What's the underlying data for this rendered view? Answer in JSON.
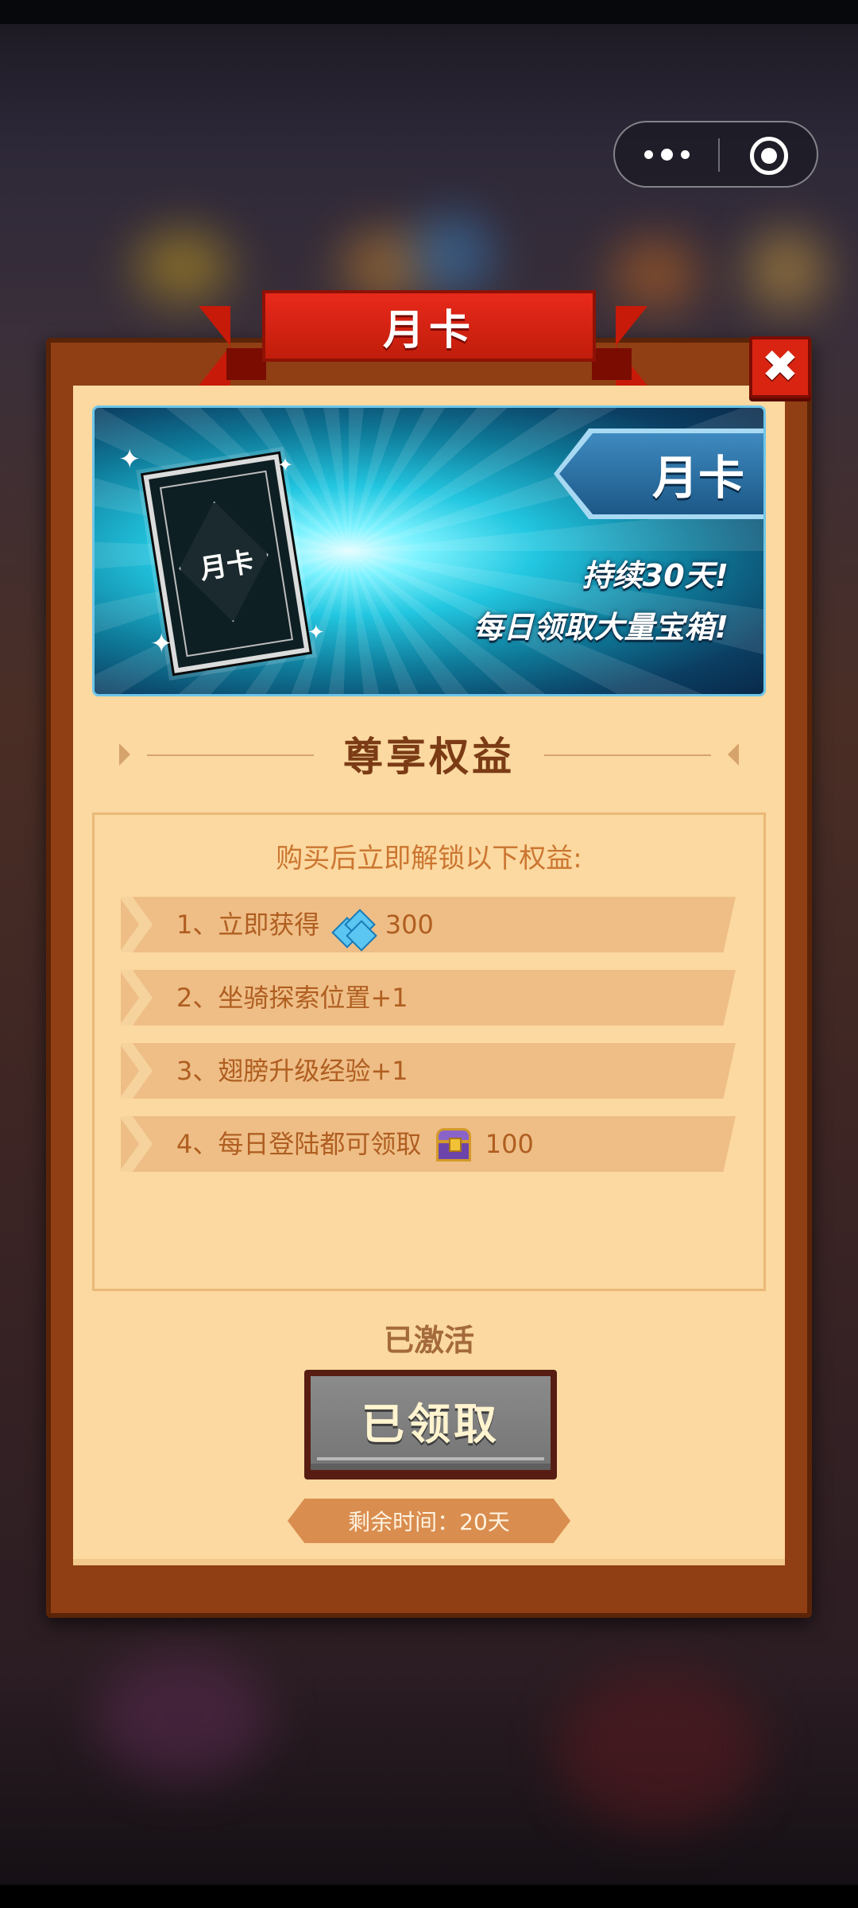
{
  "capsule": {
    "more_icon": "more-dots-icon",
    "close_icon": "target-circle-icon"
  },
  "modal": {
    "title": "月卡",
    "close_icon": "close-x-icon",
    "banner": {
      "card_label": "月卡",
      "tag_label": "月卡",
      "line1": "持续30天!",
      "line2": "每日领取大量宝箱!"
    },
    "section_title": "尊享权益",
    "benefits_intro": "购买后立即解锁以下权益:",
    "benefits": [
      {
        "text": "1、立即获得",
        "icon": "gem-icon",
        "amount": "300"
      },
      {
        "text": "2、坐骑探索位置+1"
      },
      {
        "text": "3、翅膀升级经验+1"
      },
      {
        "text": "4、每日登陆都可领取",
        "icon": "chest-icon",
        "amount": "100"
      }
    ],
    "status": "已激活",
    "claim_button": "已领取",
    "remaining_time": "剩余时间：20天"
  },
  "colors": {
    "frame": "#8f3f13",
    "panel": "#fbd9a0",
    "ribbon": "#c81a08",
    "text_brown": "#7b3b15",
    "benefit_text": "#b05e21"
  }
}
